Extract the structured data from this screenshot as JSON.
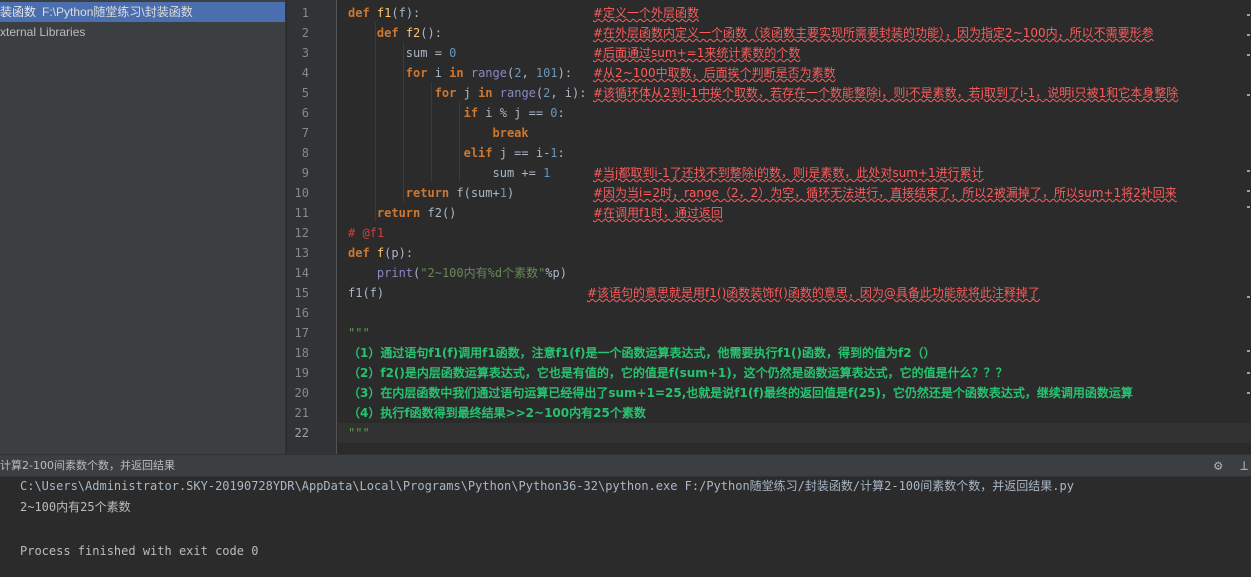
{
  "project": {
    "root_name": "装函数",
    "root_path": "F:\\Python随堂练习\\封装函数",
    "external_libraries": "xternal Libraries"
  },
  "editor": {
    "line_numbers": [
      "1",
      "2",
      "3",
      "4",
      "5",
      "6",
      "7",
      "8",
      "9",
      "10",
      "11",
      "12",
      "13",
      "14",
      "15",
      "16",
      "17",
      "18",
      "19",
      "20",
      "21",
      "22"
    ],
    "comments": {
      "c1": "#定义一个外层函数",
      "c2": "#在外层函数内定义一个函数（该函数主要实现所需要封装的功能），因为指定2~100内，所以不需要形参",
      "c3": "#后面通过sum+=1来统计素数的个数",
      "c4": "#从2~100中取数，后面挨个判断是否为素数",
      "c5": "#该循环体从2到i-1中挨个取数，若存在一个数能整除i，则i不是素数，若j取到了i-1，说明i只被1和它本身整除",
      "c9": "#当j都取到i-1了还找不到整除i的数，则i是素数，此处对sum+1进行累计",
      "c10": "#因为当i=2时，range（2，2）为空，循环无法进行，直接结束了，所以2被漏掉了，所以sum+1将2补回来",
      "c11": "#在调用f1时，通过返回",
      "c15": "#该语句的意思就是用f1()函数装饰f()函数的意思，因为@具备此功能就将此注释掉了"
    },
    "docstring": {
      "open": "\"\"\"",
      "d18": "（1）通过语句f1(f)调用f1函数，注意f1(f)是一个函数运算表达式，他需要执行f1()函数，得到的值为f2（）",
      "d19": "（2）f2()是内层函数运算表达式，它也是有值的，它的值是f(sum+1)，这个仍然是函数运算表达式，它的值是什么？？？",
      "d20": "（3）在内层函数中我们通过语句运算已经得出了sum+1=25,也就是说f1(f)最终的返回值是f(25)，它仍然还是个函数表达式，继续调用函数运算",
      "d21": "（4）执行f函数得到最终结果>>2~100内有25个素数",
      "close": "\"\"\""
    }
  },
  "run": {
    "title": "计算2-100间素数个数，并返回结果",
    "command": "C:\\Users\\Administrator.SKY-20190728YDR\\AppData\\Local\\Programs\\Python\\Python36-32\\python.exe F:/Python随堂练习/封装函数/计算2-100间素数个数，并返回结果.py",
    "output": "2~100内有25个素数",
    "exit": "Process finished with exit code 0"
  },
  "icons": {
    "gear": "gear-icon",
    "minimize": "minimize-icon"
  },
  "colors": {
    "keyword": "#cc7832",
    "number": "#6897bb",
    "builtin": "#8888c6",
    "comment_red": "#ff5c5c",
    "docstring_green": "#27c26f",
    "selection": "#4b6eaf"
  }
}
